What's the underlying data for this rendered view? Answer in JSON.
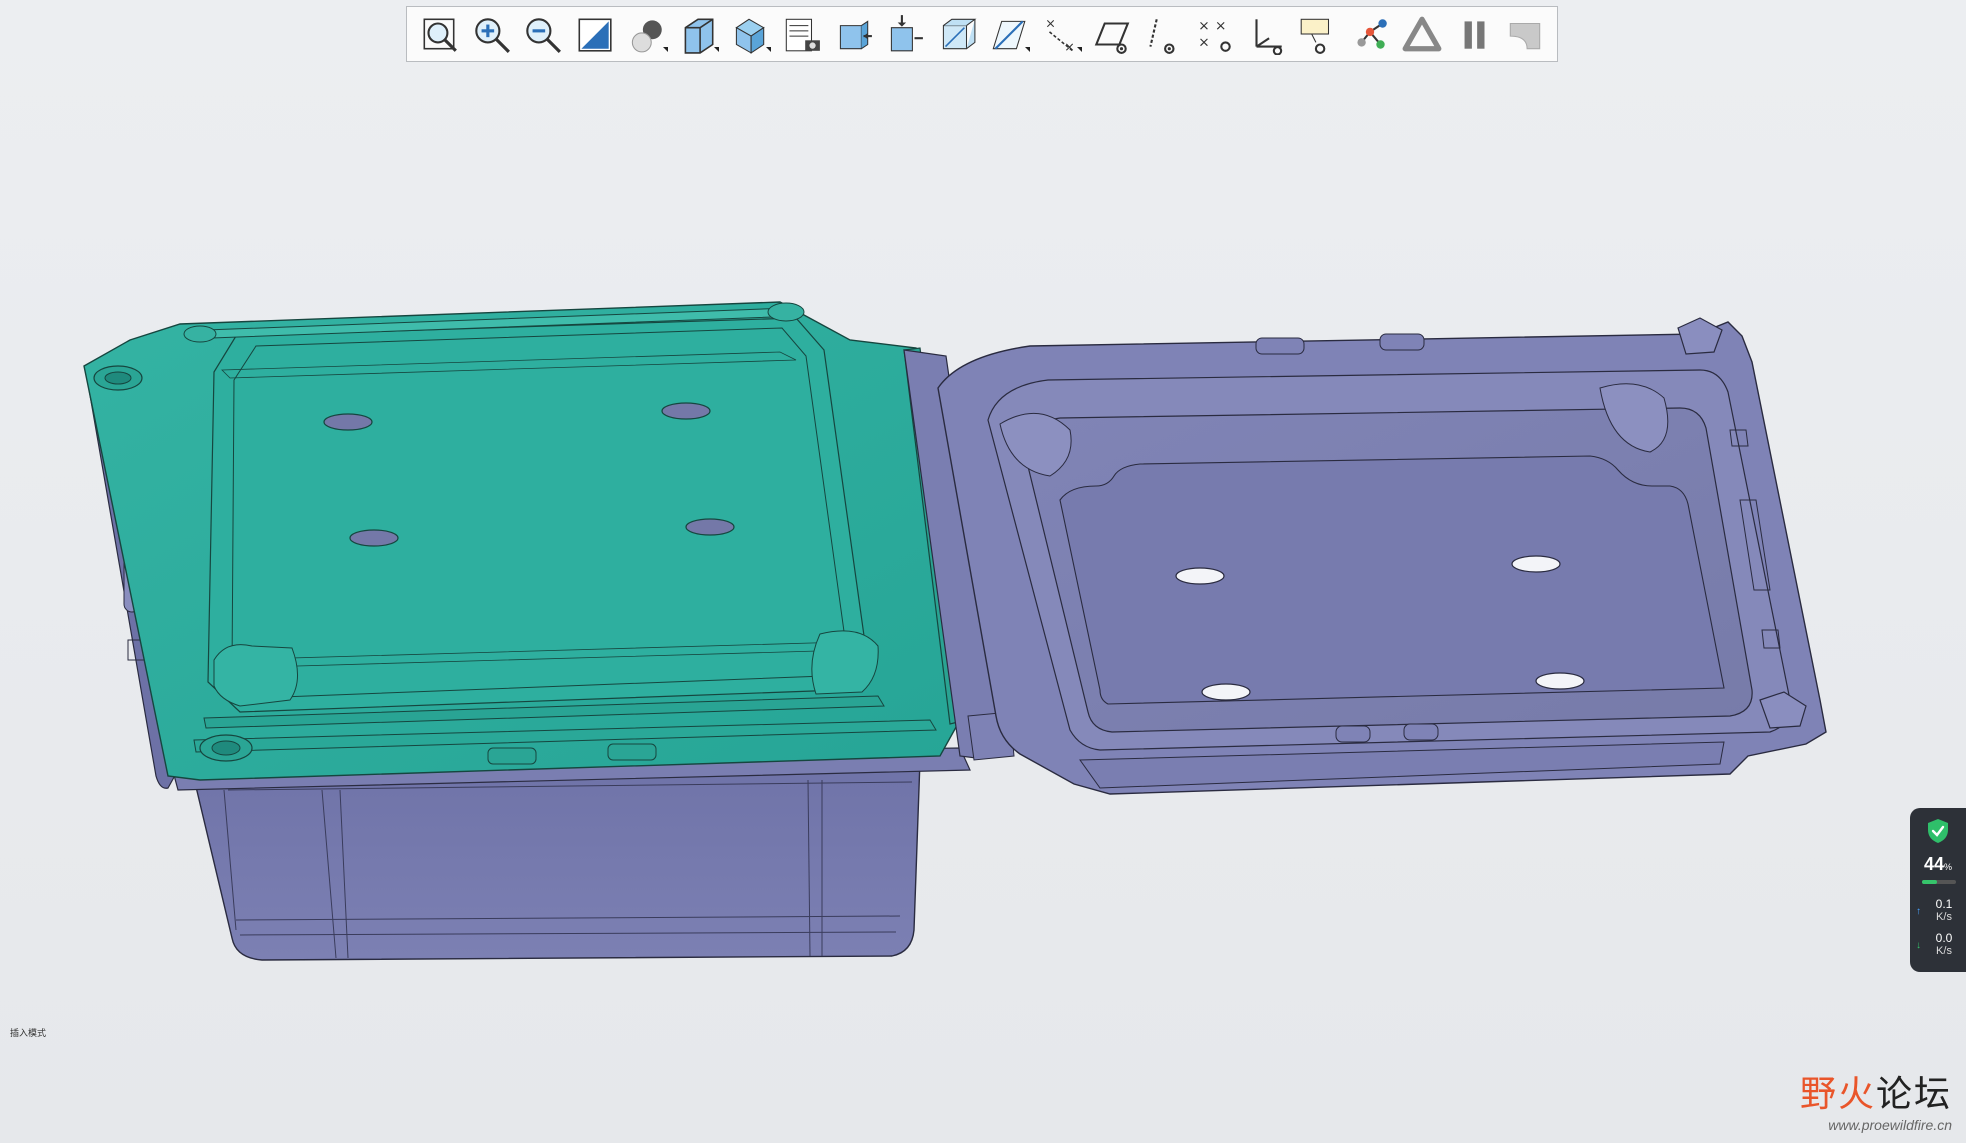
{
  "toolbar": {
    "buttons": [
      {
        "name": "refit-button",
        "icon": "zoom-fit-icon"
      },
      {
        "name": "zoom-in-button",
        "icon": "zoom-in-icon"
      },
      {
        "name": "zoom-out-button",
        "icon": "zoom-out-icon"
      },
      {
        "name": "repaint-button",
        "icon": "repaint-icon"
      },
      {
        "name": "display-style-button",
        "icon": "shaded-sphere-icon",
        "has_menu": true
      },
      {
        "name": "saved-orientations-button",
        "icon": "cube-orientation-icon",
        "has_menu": true
      },
      {
        "name": "named-views-button",
        "icon": "named-view-cube-icon",
        "has_menu": true
      },
      {
        "name": "view-manager-button",
        "icon": "view-manager-icon"
      },
      {
        "name": "perspective-view-button",
        "icon": "perspective-box-icon"
      },
      {
        "name": "section-button",
        "icon": "section-insert-icon"
      },
      {
        "name": "transparency-button",
        "icon": "transparent-box-icon"
      },
      {
        "name": "plane-display-button",
        "icon": "datum-plane-icon",
        "has_menu": true
      },
      {
        "name": "axis-display-button",
        "icon": "datum-axis-display-icon",
        "has_menu": true
      },
      {
        "name": "plane-tag-display-button",
        "icon": "plane-tag-icon"
      },
      {
        "name": "axis-tag-display-button",
        "icon": "axis-tag-icon"
      },
      {
        "name": "point-display-button",
        "icon": "datum-point-icon"
      },
      {
        "name": "csys-display-button",
        "icon": "csys-icon"
      },
      {
        "name": "annotation-display-button",
        "icon": "annotation-icon"
      },
      {
        "name": "spin-center-button",
        "icon": "spin-center-icon"
      },
      {
        "name": "shaded-triangle-button",
        "icon": "triangle-icon"
      },
      {
        "name": "pause-button",
        "icon": "pause-icon"
      },
      {
        "name": "curvature-button",
        "icon": "curvature-icon"
      }
    ]
  },
  "status": {
    "mode_label": "插入模式"
  },
  "net_monitor": {
    "percent": "44",
    "percent_unit": "%",
    "cpu_fraction": 0.44,
    "upload_value": "0.1",
    "upload_unit": "K/s",
    "download_value": "0.0",
    "download_unit": "K/s",
    "accent": "#36c46b"
  },
  "watermark": {
    "title_prefix": "野",
    "title_accent": "火",
    "title_suffix": "论坛",
    "url": "www.proewildfire.cn"
  },
  "colors": {
    "lid_teal": "#2bab9b",
    "tray_purple": "#7b7fb2",
    "background": "#e9ecef"
  }
}
